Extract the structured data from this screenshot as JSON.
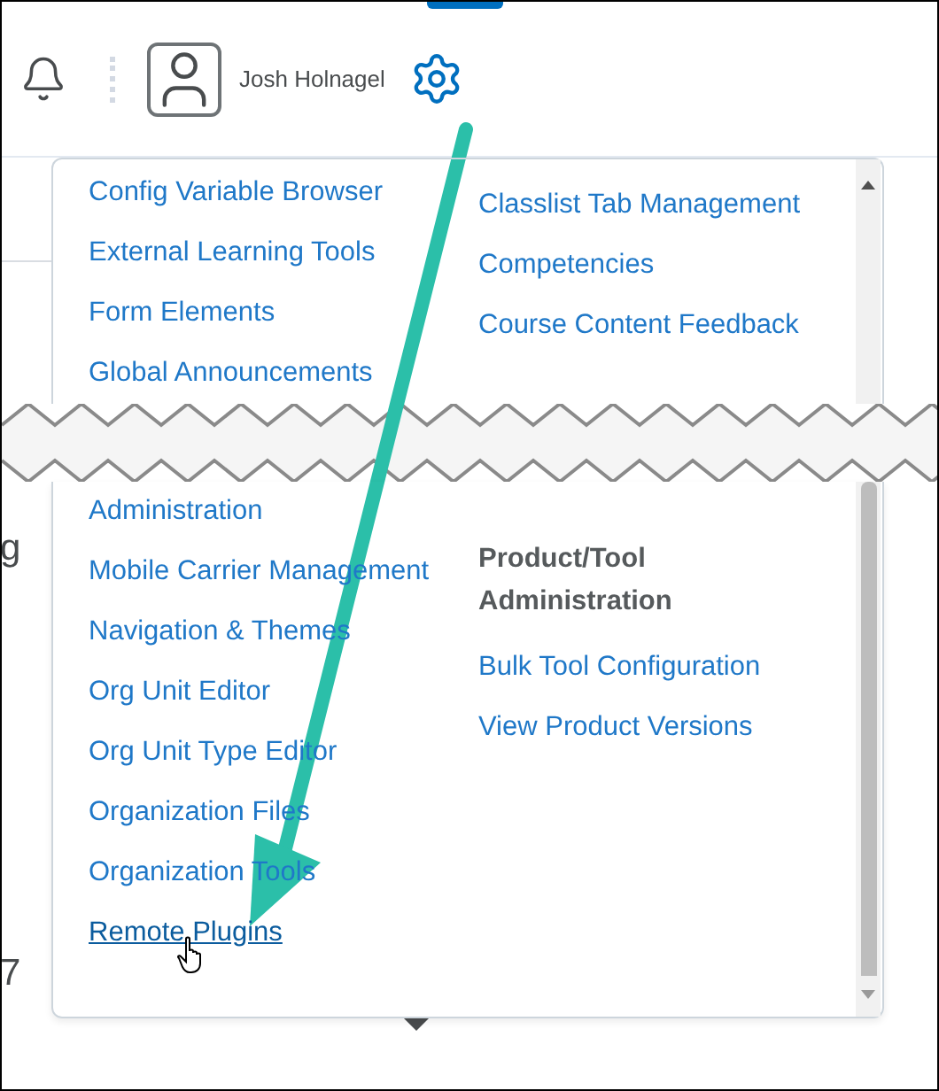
{
  "header": {
    "user_name": "Josh Holnagel"
  },
  "menu_top": {
    "left": [
      {
        "label": "Config Variable Browser",
        "kind": "link",
        "hovered": false
      },
      {
        "label": "External Learning Tools",
        "kind": "link",
        "hovered": false
      },
      {
        "label": "Form Elements",
        "kind": "link",
        "hovered": false
      },
      {
        "label": "Global Announcements",
        "kind": "link",
        "hovered": false
      }
    ],
    "right": [
      {
        "label": "Classlist Tab Management",
        "kind": "link",
        "hovered": false
      },
      {
        "label": "Competencies",
        "kind": "link",
        "hovered": false
      },
      {
        "label": "Course Content Feedback",
        "kind": "link",
        "hovered": false
      }
    ]
  },
  "menu_bottom": {
    "left": [
      {
        "label": "Administration",
        "kind": "link",
        "hovered": false
      },
      {
        "label": "Mobile Carrier Management",
        "kind": "link",
        "hovered": false
      },
      {
        "label": "Navigation & Themes",
        "kind": "link",
        "hovered": false
      },
      {
        "label": "Org Unit Editor",
        "kind": "link",
        "hovered": false
      },
      {
        "label": "Org Unit Type Editor",
        "kind": "link",
        "hovered": false
      },
      {
        "label": "Organization Files",
        "kind": "link",
        "hovered": false
      },
      {
        "label": "Organization Tools",
        "kind": "link",
        "hovered": false
      },
      {
        "label": "Remote Plugins",
        "kind": "link",
        "hovered": true
      }
    ],
    "right": [
      {
        "label": "Product/Tool Administration",
        "kind": "heading"
      },
      {
        "label": "Bulk Tool Configuration",
        "kind": "link",
        "hovered": false
      },
      {
        "label": "View Product Versions",
        "kind": "link",
        "hovered": false
      }
    ]
  },
  "background_texts": [
    "g",
    "7"
  ]
}
